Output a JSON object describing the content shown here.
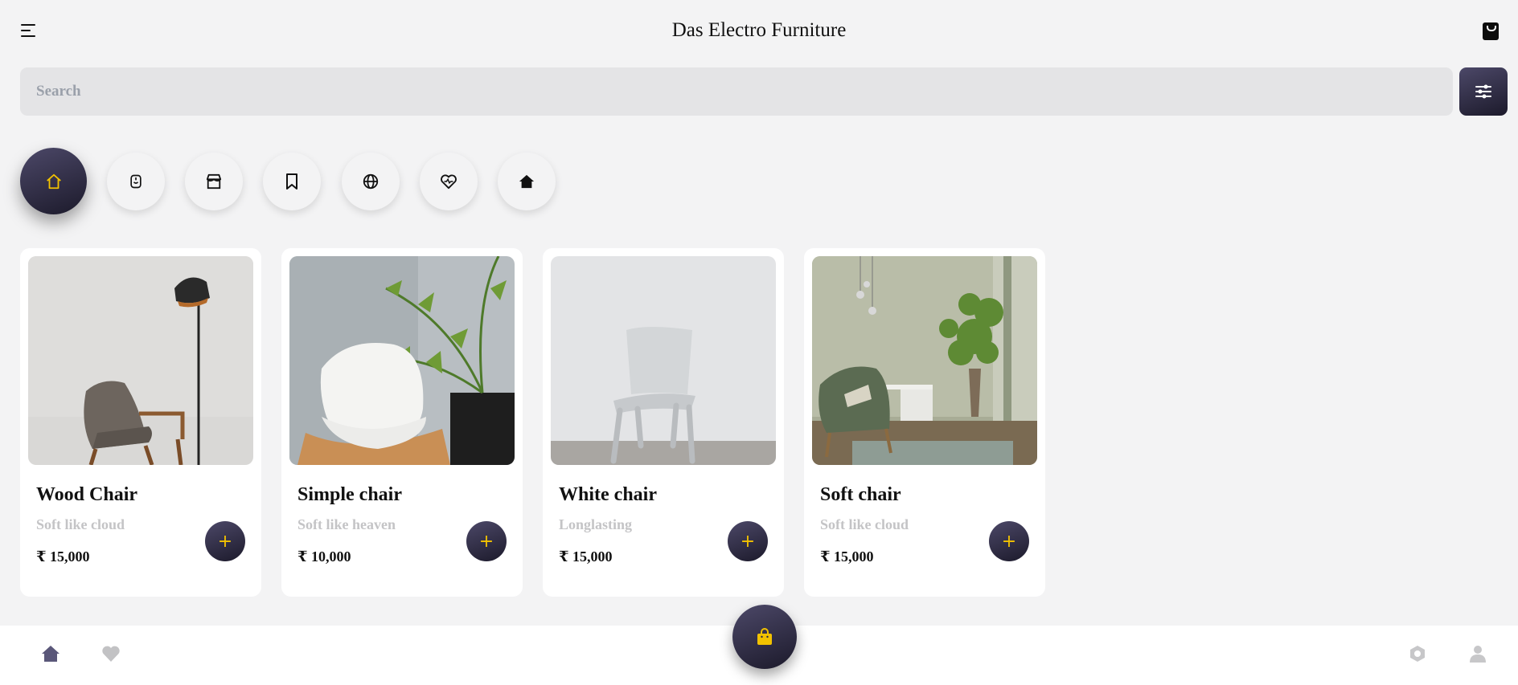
{
  "app": {
    "title": "Das Electro Furniture"
  },
  "header": {
    "menu_icon": "hamburger-menu-icon",
    "cart_icon": "shopping-bag-icon"
  },
  "search": {
    "placeholder": "Search",
    "value": "",
    "filter_icon": "sliders-icon"
  },
  "categories": [
    {
      "icon": "home-outline-icon",
      "active": true
    },
    {
      "icon": "smile-tag-icon",
      "active": false
    },
    {
      "icon": "store-icon",
      "active": false
    },
    {
      "icon": "bookmark-icon",
      "active": false
    },
    {
      "icon": "globe-icon",
      "active": false
    },
    {
      "icon": "heart-pulse-icon",
      "active": false
    },
    {
      "icon": "home-filled-icon",
      "active": false
    }
  ],
  "products": [
    {
      "name": "Wood Chair",
      "subtitle": "Soft like cloud",
      "price": "₹ 15,000"
    },
    {
      "name": "Simple chair",
      "subtitle": "Soft like heaven",
      "price": "₹ 10,000"
    },
    {
      "name": "White chair",
      "subtitle": "Longlasting",
      "price": "₹ 15,000"
    },
    {
      "name": "Soft chair",
      "subtitle": "Soft like cloud",
      "price": "₹ 15,000"
    }
  ],
  "add_button_label": "+",
  "bottom_nav": {
    "items": [
      {
        "icon": "home-icon",
        "active": true
      },
      {
        "icon": "heart-icon",
        "active": false
      },
      {
        "icon": "hexagon-icon",
        "active": false
      },
      {
        "icon": "user-icon",
        "active": false
      }
    ],
    "fab_icon": "shopping-bag-icon"
  },
  "colors": {
    "accent_dark": "#2e2b44",
    "accent_yellow": "#f2c200",
    "background": "#f3f3f4",
    "muted_text": "#c4c4c6"
  }
}
